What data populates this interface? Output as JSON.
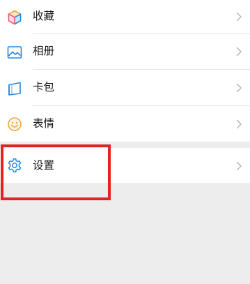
{
  "menu": {
    "items": [
      {
        "label": "收藏",
        "icon": "cube-icon"
      },
      {
        "label": "相册",
        "icon": "image-icon"
      },
      {
        "label": "卡包",
        "icon": "wallet-card-icon"
      },
      {
        "label": "表情",
        "icon": "smiley-icon"
      }
    ],
    "settings": {
      "label": "设置",
      "icon": "gear-icon"
    }
  },
  "colors": {
    "page_bg": "#ededed",
    "row_bg": "#ffffff",
    "highlight_border": "#e02424",
    "blue_icon": "#1e88e5",
    "smiley_icon": "#f0a83c",
    "chevron": "#b2b2b2"
  }
}
